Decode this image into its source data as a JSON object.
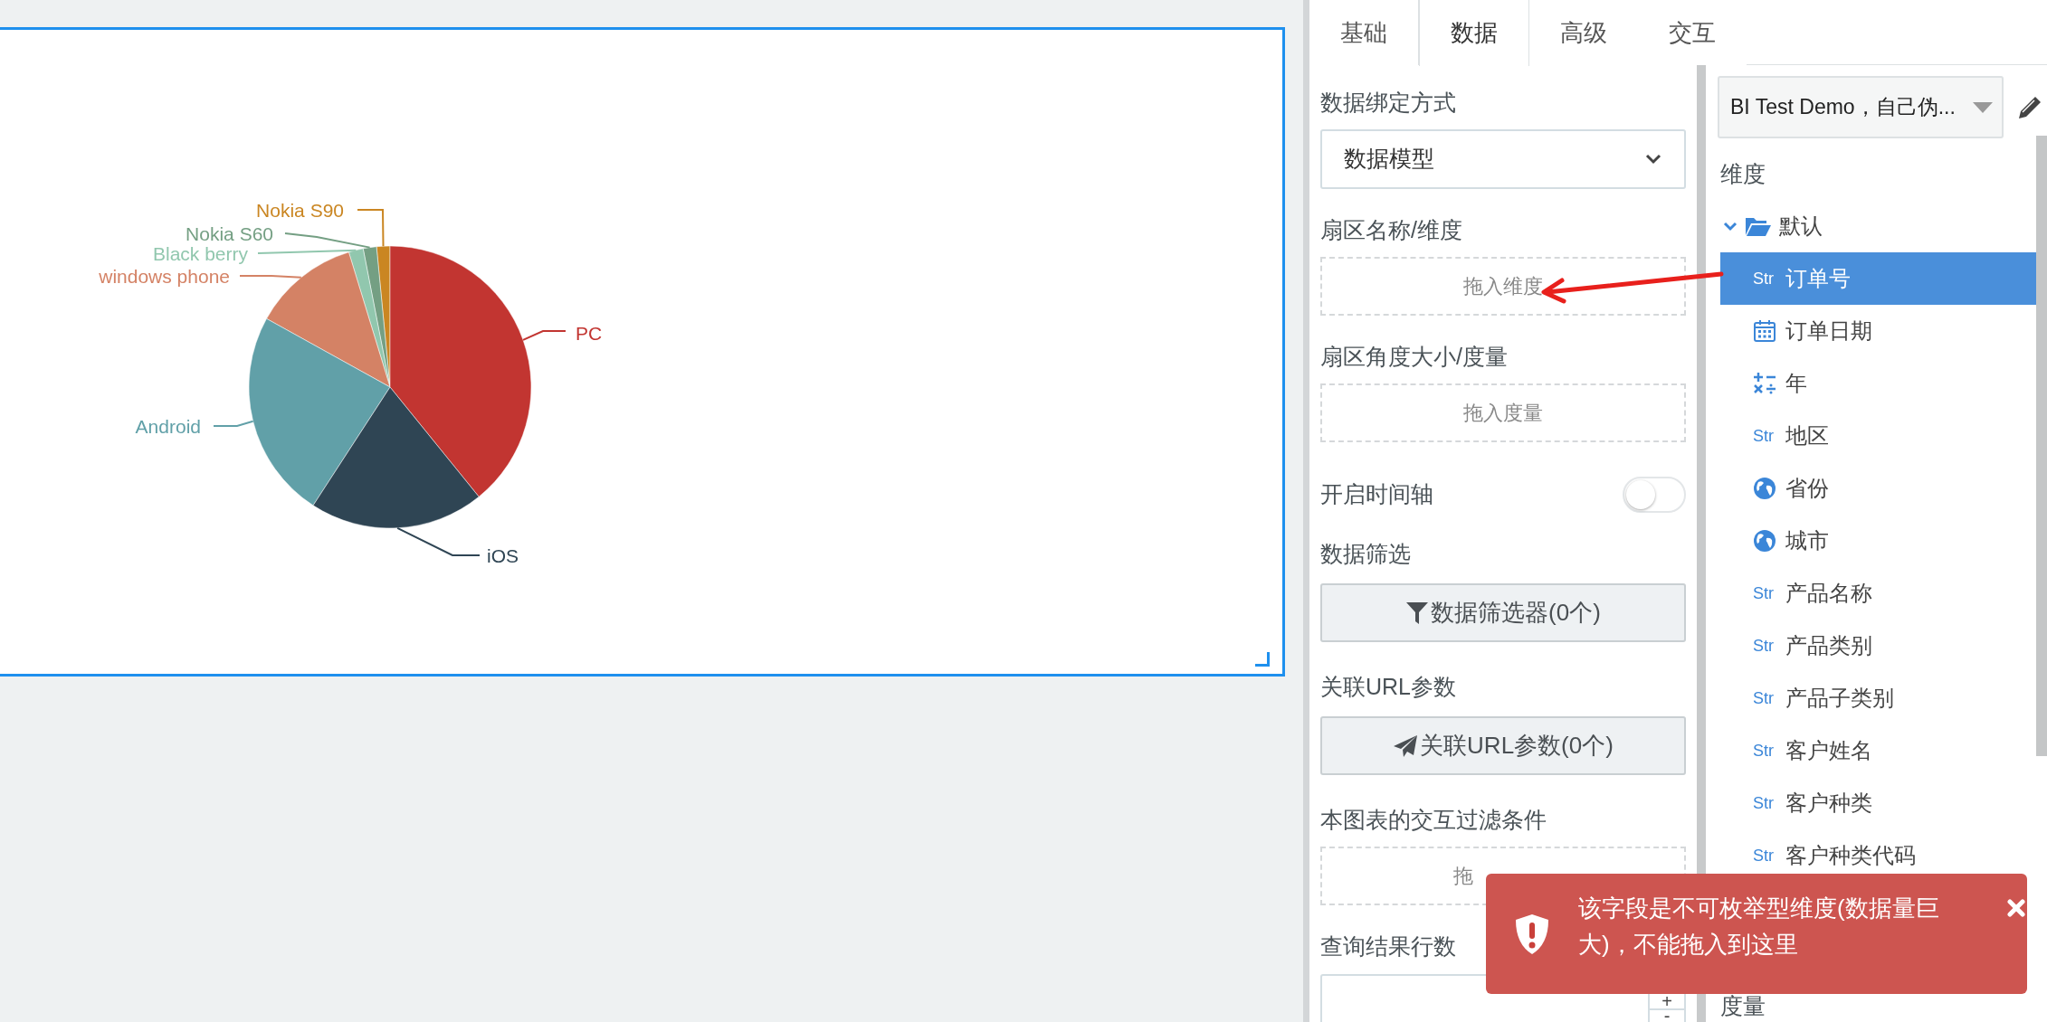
{
  "canvas": {
    "pie_chart": {
      "slices": [
        {
          "label": "Nokia S90",
          "color": "#ca8622"
        },
        {
          "label": "Nokia S60",
          "color": "#749f83"
        },
        {
          "label": "Black berry",
          "color": "#91c7ae"
        },
        {
          "label": "windows phone",
          "color": "#d48265"
        },
        {
          "label": "PC",
          "color": "#c23531"
        },
        {
          "label": "Android",
          "color": "#61a0a8"
        },
        {
          "label": "iOS",
          "color": "#2f4554"
        }
      ]
    }
  },
  "tabs": [
    {
      "label": "基础",
      "selected": false
    },
    {
      "label": "数据",
      "selected": true
    },
    {
      "label": "高级",
      "selected": false
    },
    {
      "label": "交互",
      "selected": false
    }
  ],
  "data_panel": {
    "fields": [
      {
        "kind": "select",
        "label": "数据绑定方式",
        "value": "数据模型"
      },
      {
        "kind": "dropzone",
        "label": "扇区名称/维度",
        "placeholder": "拖入维度"
      },
      {
        "kind": "dropzone",
        "label": "扇区角度大小/度量",
        "placeholder": "拖入度量"
      },
      {
        "kind": "toggle",
        "label": "开启时间轴",
        "on": false
      },
      {
        "kind": "filter_button",
        "label": "数据筛选",
        "button": "数据筛选器(0个)"
      },
      {
        "kind": "url_button",
        "label": "关联URL参数",
        "button": "关联URL参数(0个)"
      },
      {
        "kind": "dropzone",
        "label": "本图表的交互过滤条件",
        "placeholder": "拖",
        "partial": true
      },
      {
        "kind": "number",
        "label": "查询结果行数",
        "increment": "+",
        "decrement": "-"
      }
    ]
  },
  "field_panel": {
    "source": "BI Test Demo，自己伪...",
    "dimensions_heading": "维度",
    "tree": [
      {
        "label": "默认",
        "expanded": true,
        "children": [
          {
            "label": "订单号",
            "kind": "str",
            "badge": "Str",
            "selected": true
          },
          {
            "label": "订单日期",
            "kind": "date",
            "selected": false
          },
          {
            "label": "年",
            "kind": "calc",
            "selected": false
          },
          {
            "label": "地区",
            "kind": "str",
            "badge": "Str",
            "selected": false
          },
          {
            "label": "省份",
            "kind": "geo",
            "selected": false
          },
          {
            "label": "城市",
            "kind": "geo",
            "selected": false
          },
          {
            "label": "产品名称",
            "kind": "str",
            "badge": "Str",
            "selected": false
          },
          {
            "label": "产品类别",
            "kind": "str",
            "badge": "Str",
            "selected": false
          },
          {
            "label": "产品子类别",
            "kind": "str",
            "badge": "Str",
            "selected": false
          },
          {
            "label": "客户姓名",
            "kind": "str",
            "badge": "Str",
            "selected": false
          },
          {
            "label": "客户种类",
            "kind": "str",
            "badge": "Str",
            "selected": false
          },
          {
            "label": "客户种类代码",
            "kind": "str",
            "badge": "Str",
            "selected": false
          }
        ]
      }
    ],
    "measures_heading": "度量"
  },
  "toast": {
    "message": "该字段是不可枚举型维度(数据量巨大)，不能拖入到这里"
  }
}
